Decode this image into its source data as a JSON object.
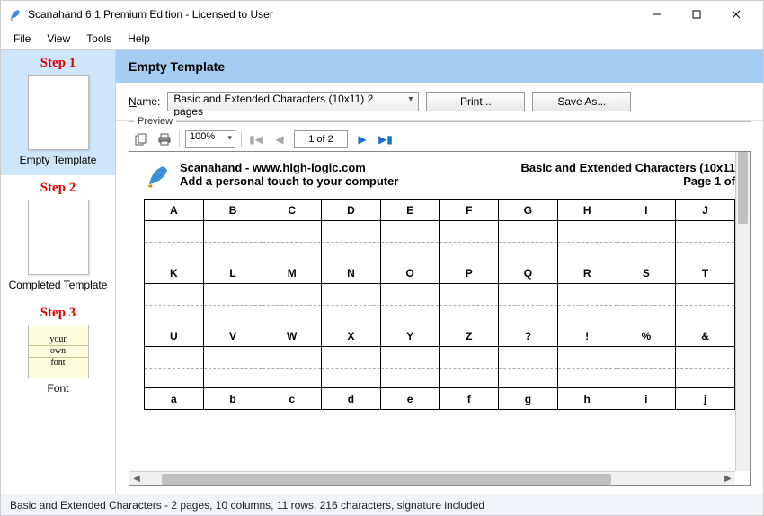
{
  "titlebar": {
    "text": "Scanahand 6.1 Premium Edition - Licensed to User"
  },
  "menu": {
    "file": "File",
    "view": "View",
    "tools": "Tools",
    "help": "Help"
  },
  "sidebar": {
    "items": [
      {
        "step": "Step 1",
        "caption": "Empty Template"
      },
      {
        "step": "Step 2",
        "caption": "Completed Template"
      },
      {
        "step": "Step 3",
        "caption": "Font",
        "line1": "your",
        "line2": "own",
        "line3": "font"
      }
    ]
  },
  "content": {
    "header": "Empty Template",
    "name_label_pre": "N",
    "name_label_rest": "ame:",
    "template_name": "Basic and Extended Characters (10x11) 2 pages",
    "print_btn": "Print...",
    "saveas_btn": "Save As...",
    "preview_label": "Preview",
    "zoom": "100%",
    "page_of": "1 of 2"
  },
  "page": {
    "brand": "Scanahand - www.high-logic.com",
    "tagline": "Add a personal touch to your computer",
    "title_right": "Basic and Extended Characters (10x11",
    "page_right": "Page 1 of"
  },
  "chart_data": {
    "type": "table",
    "title": "Character template grid",
    "columns": 10,
    "rows": [
      [
        "A",
        "B",
        "C",
        "D",
        "E",
        "F",
        "G",
        "H",
        "I",
        "J"
      ],
      [
        "K",
        "L",
        "M",
        "N",
        "O",
        "P",
        "Q",
        "R",
        "S",
        "T"
      ],
      [
        "U",
        "V",
        "W",
        "X",
        "Y",
        "Z",
        "?",
        "!",
        "%",
        "&"
      ],
      [
        "a",
        "b",
        "c",
        "d",
        "e",
        "f",
        "g",
        "h",
        "i",
        "j"
      ]
    ]
  },
  "statusbar": {
    "text": "Basic and Extended Characters - 2 pages, 10 columns, 11 rows, 216 characters, signature included"
  }
}
